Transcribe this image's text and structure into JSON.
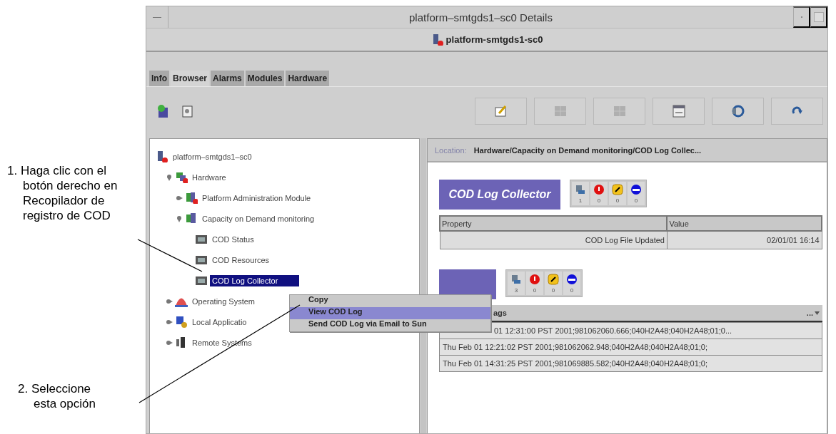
{
  "annotations": [
    {
      "lines": [
        "1. Haga clic con el",
        "botón derecho en",
        "Recopilador de",
        "registro de COD"
      ]
    },
    {
      "lines": [
        "2. Seleccione",
        "esta opción"
      ]
    }
  ],
  "window": {
    "title": "platform–smtgds1–sc0 Details",
    "subtitle": "platform-smtgds1-sc0"
  },
  "tabs": [
    {
      "label": "Info",
      "selected": false
    },
    {
      "label": "Browser",
      "selected": true
    },
    {
      "label": "Alarms",
      "selected": false
    },
    {
      "label": "Modules",
      "selected": false
    },
    {
      "label": "Hardware",
      "selected": false
    }
  ],
  "toolbar": {
    "buttons": [
      {
        "kind": "edit",
        "disabled": false
      },
      {
        "kind": "grid",
        "disabled": true
      },
      {
        "kind": "grid",
        "disabled": true
      },
      {
        "kind": "calendar",
        "disabled": false
      },
      {
        "kind": "sync",
        "disabled": false
      },
      {
        "kind": "redo",
        "disabled": false
      }
    ]
  },
  "tree": {
    "label": "platform–smtgds1–sc0",
    "kind": "server",
    "selected": false,
    "children": [
      {
        "label": "Hardware",
        "kind": "hardware",
        "expanded": true,
        "selected": false,
        "children": [
          {
            "label": "Platform Administration Module",
            "kind": "module",
            "expanded": false,
            "selected": false
          },
          {
            "label": "Capacity on Demand monitoring",
            "kind": "cod",
            "expanded": true,
            "selected": false,
            "children": [
              {
                "label": "COD Status",
                "kind": "table",
                "selected": false
              },
              {
                "label": "COD Resources",
                "kind": "table",
                "selected": false
              },
              {
                "label": "COD Log Collector",
                "kind": "table",
                "selected": true
              }
            ]
          }
        ]
      },
      {
        "label": "Operating System",
        "kind": "os",
        "expanded": false,
        "selected": false
      },
      {
        "label": "Local Applicatio",
        "kind": "apps",
        "expanded": false,
        "selected": false
      },
      {
        "label": "Remote Systems",
        "kind": "remote",
        "expanded": false,
        "selected": false
      }
    ]
  },
  "location": {
    "label": "Location:",
    "path": "Hardware/Capacity on Demand monitoring/COD Log Collec..."
  },
  "collector": {
    "title": "COD Log Collector",
    "status": [
      {
        "kind": "device",
        "count": "1"
      },
      {
        "kind": "critical",
        "count": "0"
      },
      {
        "kind": "warning",
        "count": "0"
      },
      {
        "kind": "down",
        "count": "0"
      }
    ],
    "table": {
      "columns": [
        "Property",
        "Value"
      ],
      "rows": [
        [
          "COD Log File Updated",
          "02/01/01 16:14"
        ]
      ]
    }
  },
  "log": {
    "status": [
      {
        "kind": "device",
        "count": "3"
      },
      {
        "kind": "critical",
        "count": "0"
      },
      {
        "kind": "warning",
        "count": "0"
      },
      {
        "kind": "down",
        "count": "0"
      }
    ],
    "table": {
      "column": "ags",
      "menu": "...",
      "rows": [
        "01 12:31:00 PST 2001;981062060.666;040H2A48;040H2A48;01;0...",
        "Thu Feb 01 12:21:02 PST 2001;981062062.948;040H2A48;040H2A48;01;0;",
        "Thu Feb 01 14:31:25 PST 2001;981069885.582;040H2A48;040H2A48;01;0;"
      ]
    }
  },
  "context_menu": [
    {
      "label": "Copy",
      "selected": false
    },
    {
      "label": "View COD Log",
      "selected": true
    },
    {
      "label": "Send COD Log via Email to Sun",
      "selected": false
    }
  ]
}
